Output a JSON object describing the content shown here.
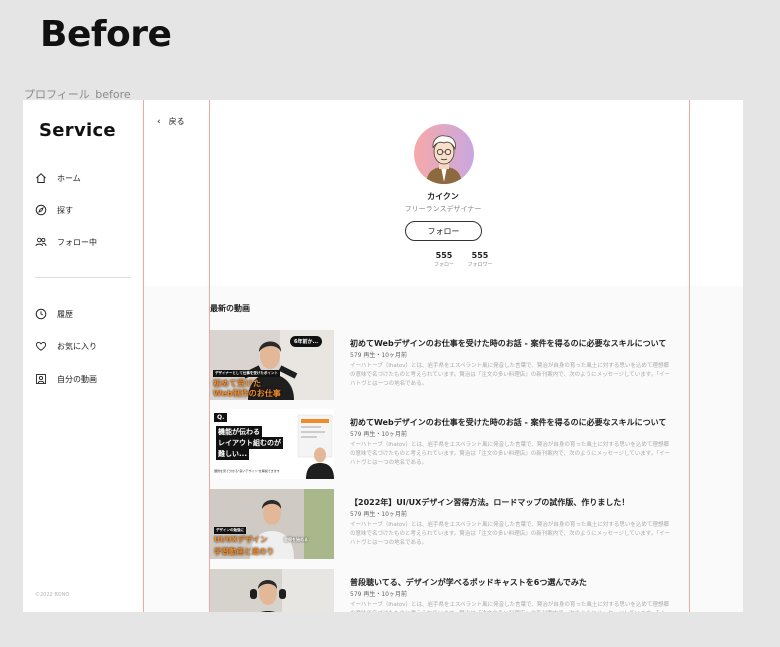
{
  "page": {
    "heading": "Before",
    "frame_label": "プロフィール_before"
  },
  "sidebar": {
    "logo": "Service",
    "items": [
      {
        "label": "ホーム",
        "icon": "home-icon"
      },
      {
        "label": "探す",
        "icon": "compass-icon"
      },
      {
        "label": "フォロー中",
        "icon": "users-icon"
      },
      {
        "label": "履歴",
        "icon": "clock-icon"
      },
      {
        "label": "お気に入り",
        "icon": "heart-icon"
      },
      {
        "label": "自分の動画",
        "icon": "user-square-icon"
      }
    ],
    "copyright": "©2022 BONO"
  },
  "header": {
    "back_label": "戻る"
  },
  "profile": {
    "name": "カイクン",
    "role": "フリーランスデザイナー",
    "follow_label": "フォロー",
    "following_count": "555",
    "following_label": "フォロー",
    "followers_count": "555",
    "followers_label": "フォロワー"
  },
  "videos_section": {
    "title": "最新の動画",
    "items": [
      {
        "title": "初めてWebデザインのお仕事を受けた時のお話 - 案件を得るのに必要なスキルについて",
        "meta": "579 再生・10ヶ月前",
        "description": "イーハトーブ（Ihatov）とは、岩手県をエスペラント風に発音した言葉で、賢治が自身の育った風土に対する思いを込めて理想郷の意味で名づけたものと考えられています。賢治は『注文の多い料理店』の新刊案内で、次のようにメッセージしています。「イーハトヴとは一つの地名である。",
        "thumb_badge": "6年前か...",
        "thumb_caption": "デザイナーとして仕事を受けたポイント",
        "thumb_line1": "初めて受けた",
        "thumb_line2": "Web制作のお仕事"
      },
      {
        "title": "初めてWebデザインのお仕事を受けた時のお話 - 案件を得るのに必要なスキルについて",
        "meta": "579 再生・10ヶ月前",
        "description": "イーハトーブ（Ihatov）とは、岩手県をエスペラント風に発音した言葉で、賢治が自身の育った風土に対する思いを込めて理想郷の意味で名づけたものと考えられています。賢治は『注文の多い料理店』の新刊案内で、次のようにメッセージしています。「イーハトヴとは一つの地名である。",
        "thumb_q": "Q.",
        "thumb_line1": "機能が伝わる",
        "thumb_line2": "レイアウト組むのが",
        "thumb_line3": "難しい...",
        "thumb_caption": "課題を見て分かる\"良いデザイン\"を解説できます"
      },
      {
        "title": "【2022年】UI/UXデザイン習得方法。ロードマップの試作版、作りました！",
        "meta": "579 再生・10ヶ月前",
        "description": "イーハトーブ（Ihatov）とは、岩手県をエスペラント風に発音した言葉で、賢治が自身の育った風土に対する思いを込めて理想郷の意味で名づけたものと考えられています。賢治は『注文の多い料理店』の新刊案内で、次のようにメッセージしています。「イーハトヴとは一つの地名である。",
        "thumb_caption": "デザインの勉強に",
        "thumb_line1": "UI/UXデザイン",
        "thumb_line1b": "習得を始める",
        "thumb_line2": "学習動画と道のり"
      },
      {
        "title": "普段聴いてる、デザインが学べるポッドキャストを6つ選んでみた",
        "meta": "579 再生・10ヶ月前",
        "description": "イーハトーブ（Ihatov）とは、岩手県をエスペラント風に発音した言葉で、賢治が自身の育った風土に対する思いを込めて理想郷の意味で名づけたものと考えられています。賢治は『注文の多い料理店』の新刊案内で、次のようにメッセージしています。「イーハトヴとは一つの地名である。"
      }
    ]
  },
  "colors": {
    "guide": "#f2a8a0",
    "orange_accent": "#f08a2a"
  }
}
